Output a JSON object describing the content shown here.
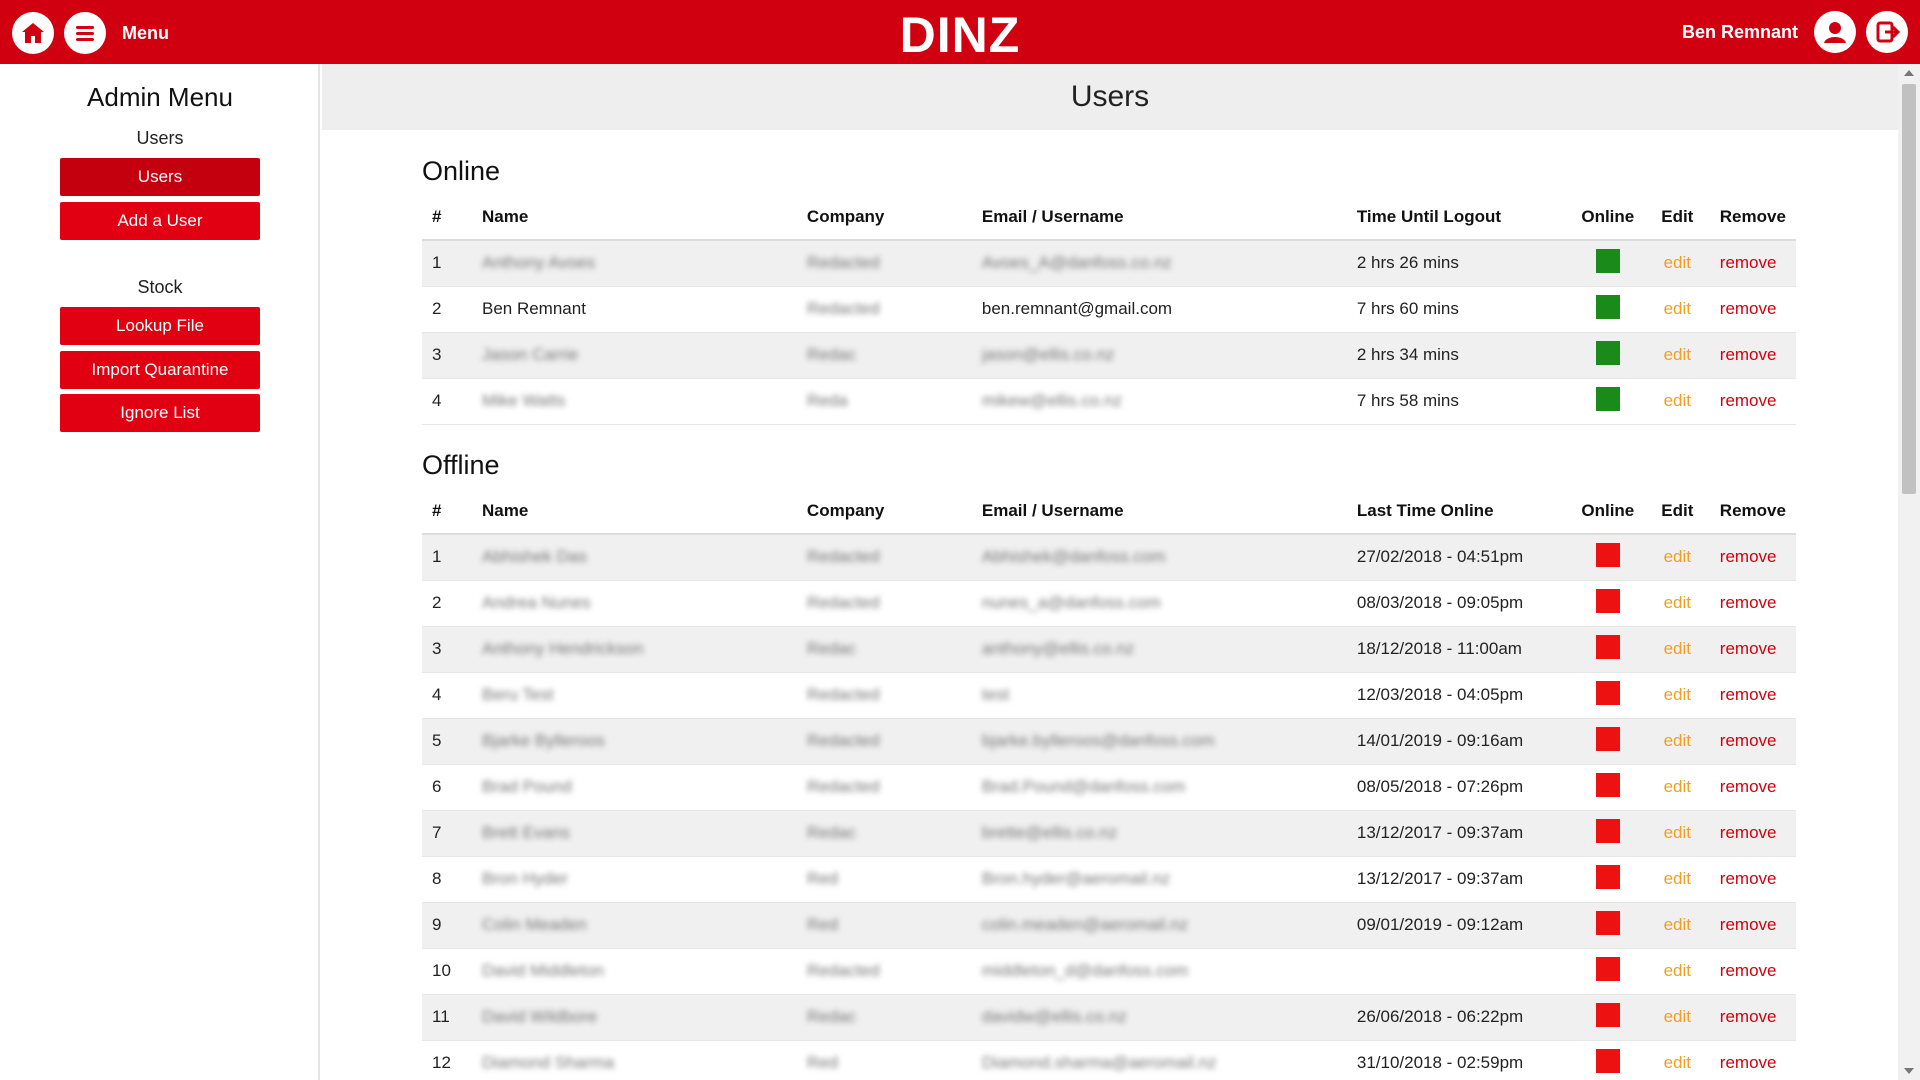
{
  "header": {
    "menu_label": "Menu",
    "brand": "DINZ",
    "user_name": "Ben Remnant",
    "accent": "#d10011"
  },
  "sidebar": {
    "title": "Admin Menu",
    "sections": [
      {
        "label": "Users",
        "items": [
          "Users",
          "Add a User"
        ]
      },
      {
        "label": "Stock",
        "items": [
          "Lookup File",
          "Import Quarantine",
          "Ignore List"
        ]
      }
    ]
  },
  "page": {
    "title": "Users"
  },
  "online": {
    "title": "Online",
    "columns": [
      "#",
      "Name",
      "Company",
      "Email / Username",
      "Time Until Logout",
      "Online",
      "Edit",
      "Remove"
    ],
    "rows": [
      {
        "num": "1",
        "name": "Anthony Avoes",
        "company": "Redacted",
        "email": "Avoes_A@danfoss.co.nz",
        "time": "2 hrs 26 mins",
        "online": true
      },
      {
        "num": "2",
        "name": "Ben Remnant",
        "company": "Redacted",
        "email": "ben.remnant@gmail.com",
        "time": "7 hrs 60 mins",
        "online": true
      },
      {
        "num": "3",
        "name": "Jason Carrie",
        "company": "Redac",
        "email": "jason@ellis.co.nz",
        "time": "2 hrs 34 mins",
        "online": true
      },
      {
        "num": "4",
        "name": "Mike Watts",
        "company": "Reda",
        "email": "mikew@ellis.co.nz",
        "time": "7 hrs 58 mins",
        "online": true
      }
    ]
  },
  "offline": {
    "title": "Offline",
    "columns": [
      "#",
      "Name",
      "Company",
      "Email / Username",
      "Last Time Online",
      "Online",
      "Edit",
      "Remove"
    ],
    "rows": [
      {
        "num": "1",
        "name": "Abhishek Das",
        "company": "Redacted",
        "email": "Abhishek@danfoss.com",
        "time": "27/02/2018 - 04:51pm",
        "online": false
      },
      {
        "num": "2",
        "name": "Andrea Nunes",
        "company": "Redacted",
        "email": "nunes_a@danfoss.com",
        "time": "08/03/2018 - 09:05pm",
        "online": false
      },
      {
        "num": "3",
        "name": "Anthony Hendrickson",
        "company": "Redac",
        "email": "anthony@ellis.co.nz",
        "time": "18/12/2018 - 11:00am",
        "online": false
      },
      {
        "num": "4",
        "name": "Beru Test",
        "company": "Redacted",
        "email": "test",
        "time": "12/03/2018 - 04:05pm",
        "online": false
      },
      {
        "num": "5",
        "name": "Bjarke Bylleroos",
        "company": "Redacted",
        "email": "bjarke.bylleroos@danfoss.com",
        "time": "14/01/2019 - 09:16am",
        "online": false
      },
      {
        "num": "6",
        "name": "Brad Pound",
        "company": "Redacted",
        "email": "Brad.Pound@danfoss.com",
        "time": "08/05/2018 - 07:26pm",
        "online": false
      },
      {
        "num": "7",
        "name": "Brett Evans",
        "company": "Redac",
        "email": "brette@ellis.co.nz",
        "time": "13/12/2017 - 09:37am",
        "online": false
      },
      {
        "num": "8",
        "name": "Bron Hyder",
        "company": "Red",
        "email": "Bron.hyder@aeromail.nz",
        "time": "13/12/2017 - 09:37am",
        "online": false
      },
      {
        "num": "9",
        "name": "Colin Meaden",
        "company": "Red",
        "email": "colin.meaden@aeromail.nz",
        "time": "09/01/2019 - 09:12am",
        "online": false
      },
      {
        "num": "10",
        "name": "David Middleton",
        "company": "Redacted",
        "email": "middleton_d@danfoss.com",
        "time": "",
        "online": false
      },
      {
        "num": "11",
        "name": "David Wildbore",
        "company": "Redac",
        "email": "davidw@ellis.co.nz",
        "time": "26/06/2018 - 06:22pm",
        "online": false
      },
      {
        "num": "12",
        "name": "Diamond Sharma",
        "company": "Red",
        "email": "Diamond.sharma@aeromail.nz",
        "time": "31/10/2018 - 02:59pm",
        "online": false
      }
    ]
  },
  "row_actions": {
    "edit": "edit",
    "remove": "remove"
  },
  "status_colors": {
    "online": "#1a8a1a",
    "offline": "#ee1111"
  }
}
